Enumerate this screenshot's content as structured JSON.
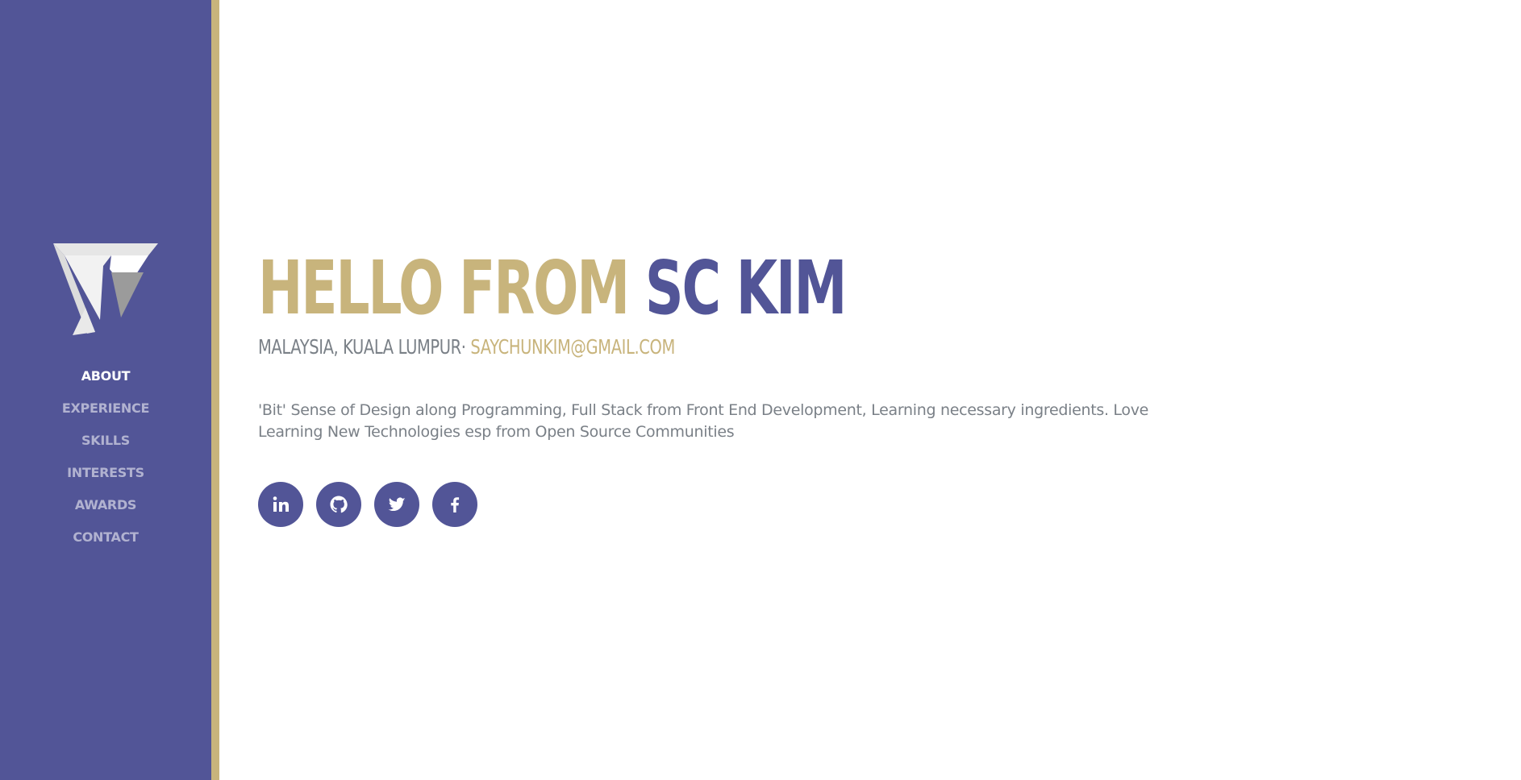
{
  "sidebar": {
    "logo": "sc-kim-logo",
    "nav": [
      {
        "label": "ABOUT",
        "active": true
      },
      {
        "label": "EXPERIENCE",
        "active": false
      },
      {
        "label": "SKILLS",
        "active": false
      },
      {
        "label": "INTERESTS",
        "active": false
      },
      {
        "label": "AWARDS",
        "active": false
      },
      {
        "label": "CONTACT",
        "active": false
      }
    ]
  },
  "hero": {
    "greeting": "HELLO FROM ",
    "name": "SC KIM",
    "location": "MALAYSIA, KUALA LUMPUR· ",
    "email": "SAYCHUNKIM@GMAIL.COM",
    "bio": "'Bit' Sense of Design along Programming, Full Stack from Front End Development, Learning necessary ingredients. Love Learning New Technologies esp from Open Source Communities"
  },
  "social": [
    {
      "icon": "linkedin-icon"
    },
    {
      "icon": "github-icon"
    },
    {
      "icon": "twitter-icon"
    },
    {
      "icon": "facebook-icon"
    }
  ],
  "colors": {
    "primary": "#525597",
    "accent": "#c8b47c",
    "text_muted": "#7a8087",
    "background": "#ffffff"
  }
}
